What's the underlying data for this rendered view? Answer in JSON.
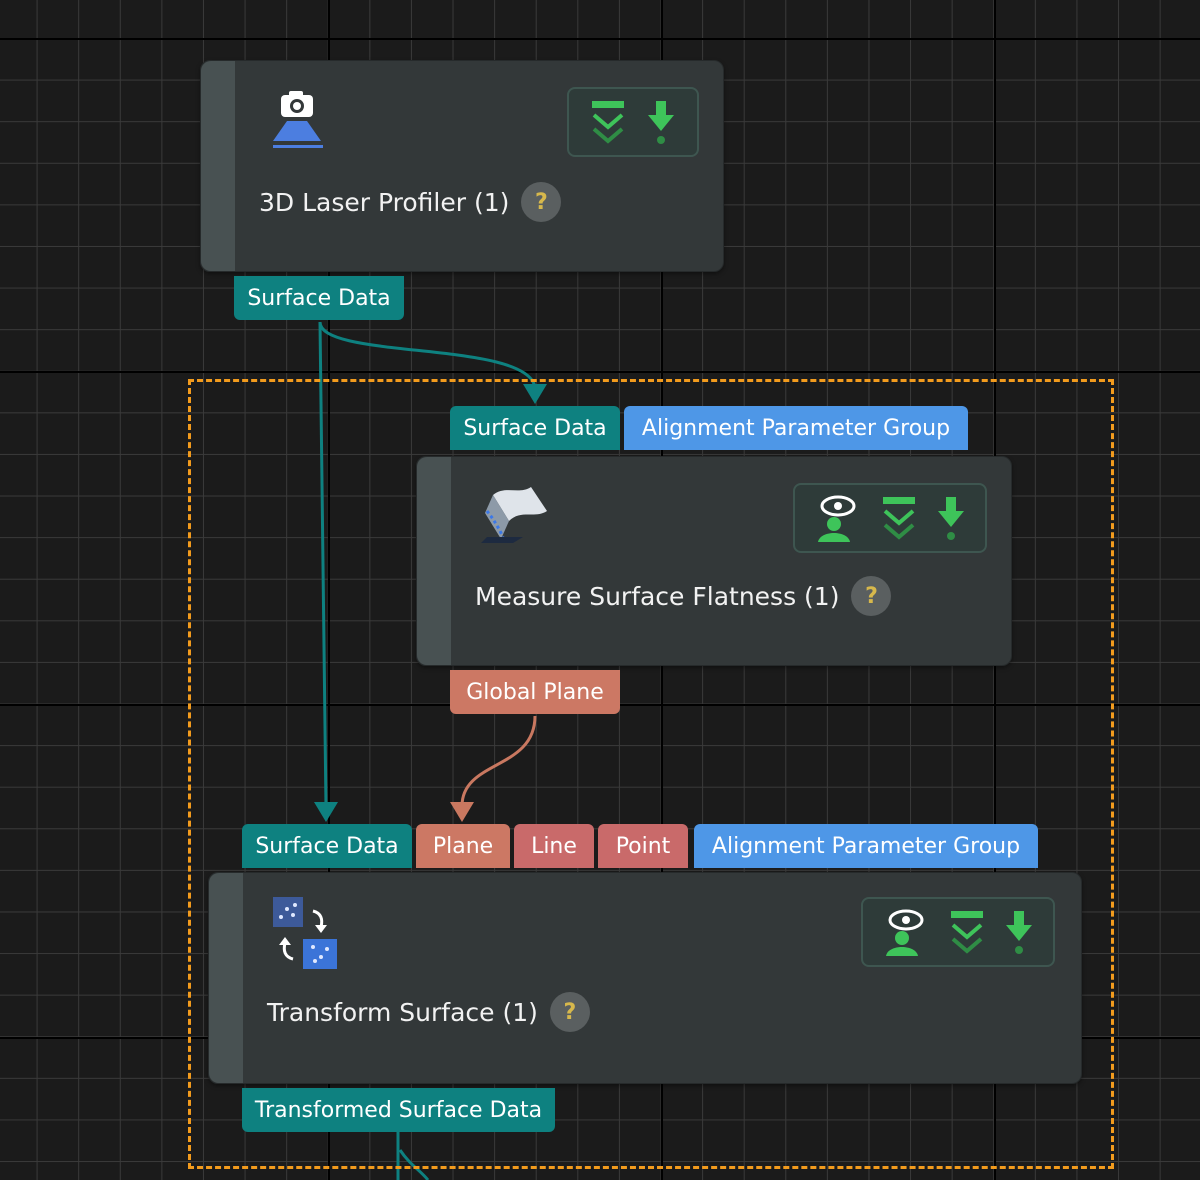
{
  "nodes": {
    "laser_profiler": {
      "title": "3D Laser Profiler (1)",
      "help": "?",
      "icon": "camera-profiler-icon",
      "outputs": [
        "Surface Data"
      ]
    },
    "measure_flatness": {
      "title": "Measure Surface Flatness (1)",
      "help": "?",
      "icon": "surface-icon",
      "inputs": [
        "Surface Data",
        "Alignment Parameter Group"
      ],
      "outputs": [
        "Global Plane"
      ]
    },
    "transform_surface": {
      "title": "Transform Surface (1)",
      "help": "?",
      "icon": "transform-icon",
      "inputs": [
        "Surface Data",
        "Plane",
        "Line",
        "Point",
        "Alignment Parameter Group"
      ],
      "outputs": [
        "Transformed Surface Data"
      ]
    }
  },
  "toolbar_icons": [
    "visualize-icon",
    "collapse-icon",
    "download-icon"
  ],
  "colors": {
    "canvas": "#1b1b1b",
    "node": "#333839",
    "teal_port": "#0e8180",
    "blue_port": "#4e97e7",
    "plane_port": "#cc7864",
    "group_border": "#f29b1d",
    "icon_green": "#3ec45a"
  }
}
